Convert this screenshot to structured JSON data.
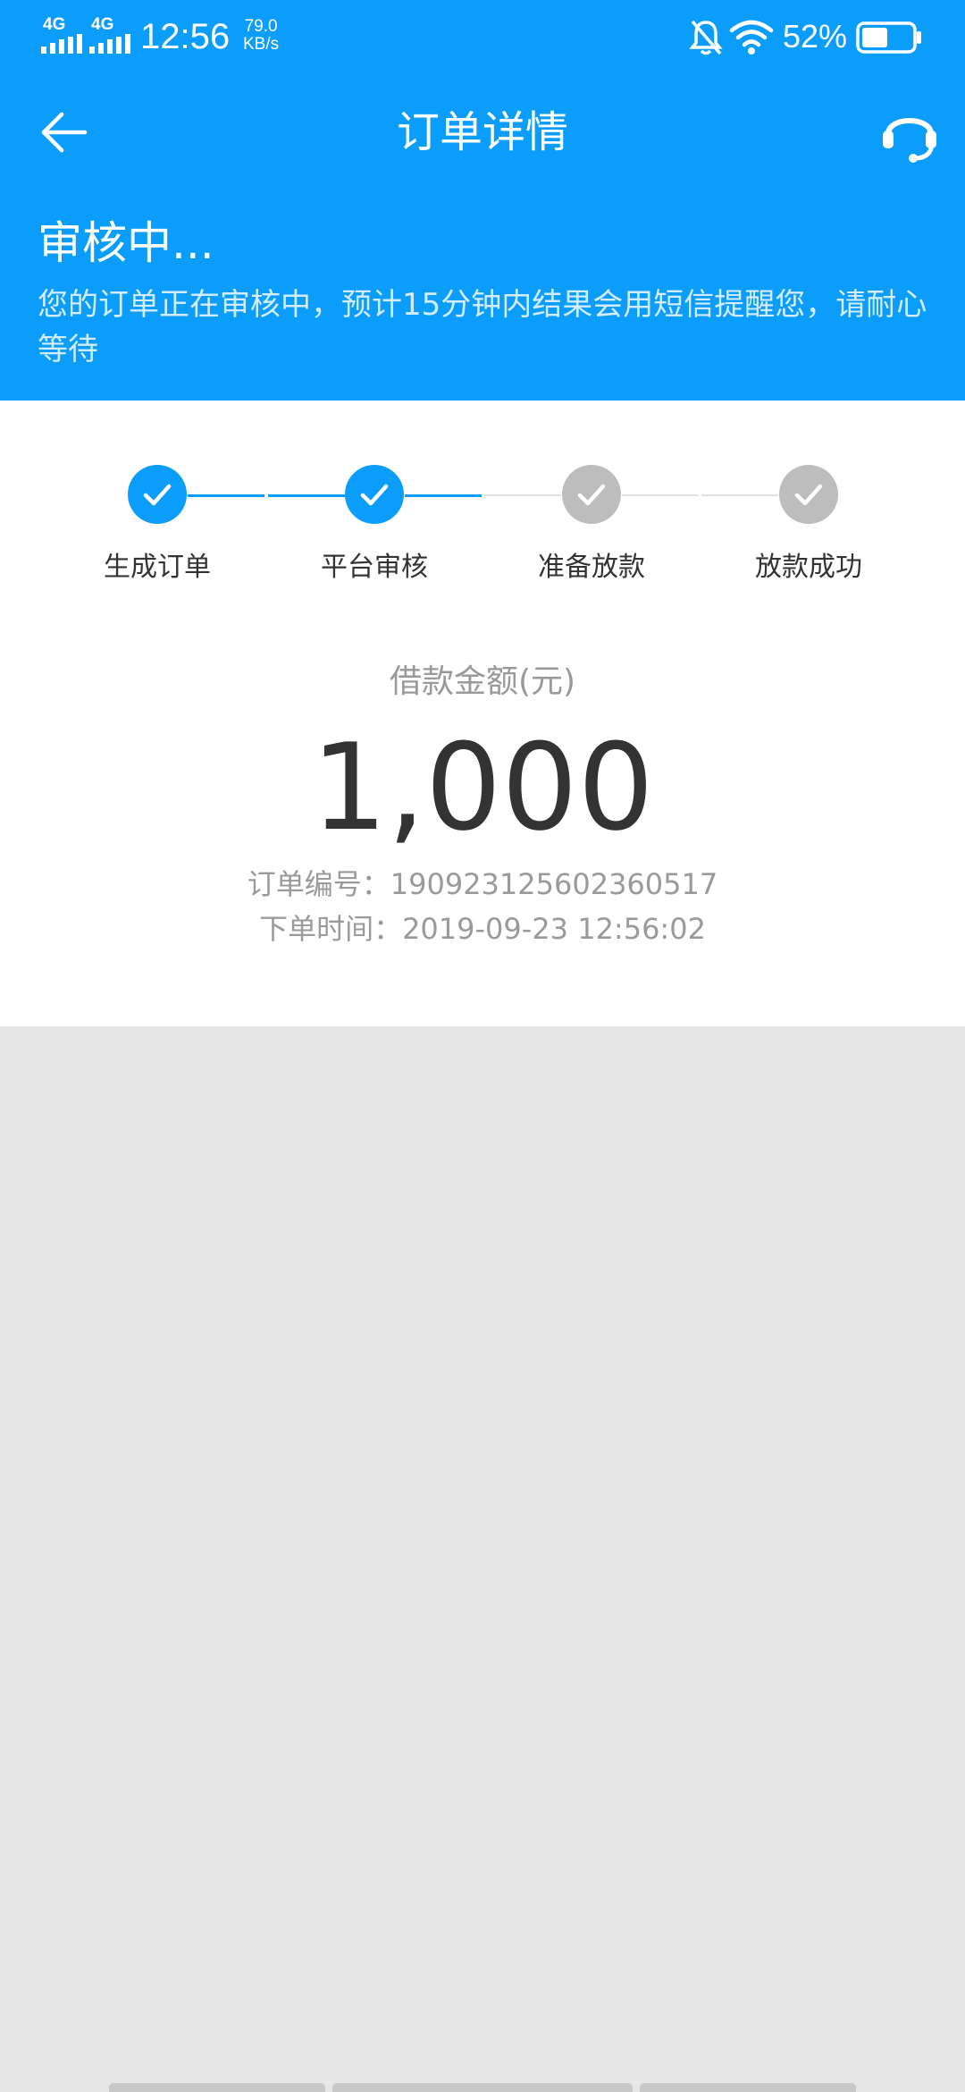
{
  "status_bar": {
    "network_1": "4G",
    "network_2": "4G",
    "time": "12:56",
    "speed_value": "79.0",
    "speed_unit": "KB/s",
    "battery_percent": "52%",
    "battery_level": 0.52,
    "icons": [
      "signal-bars-icon",
      "mute-bell-icon",
      "wifi-icon",
      "battery-icon"
    ]
  },
  "header": {
    "title": "订单详情",
    "back_icon": "back-arrow-icon",
    "support_icon": "headset-icon",
    "background_color": "#0a9dfb"
  },
  "status": {
    "title": "审核中...",
    "description": "您的订单正在审核中，预计15分钟内结果会用短信提醒您，请耐心等待"
  },
  "progress": {
    "active_color": "#0a9dfb",
    "inactive_color": "#bdbdbd",
    "steps": [
      {
        "label": "生成订单",
        "done": true
      },
      {
        "label": "平台审核",
        "done": true
      },
      {
        "label": "准备放款",
        "done": false
      },
      {
        "label": "放款成功",
        "done": false
      }
    ]
  },
  "loan": {
    "amount_label": "借款金额(元)",
    "amount": "1,000",
    "order_number": "订单编号：190923125602360517",
    "order_time": "下单时间：2019-09-23 12:56:02"
  }
}
